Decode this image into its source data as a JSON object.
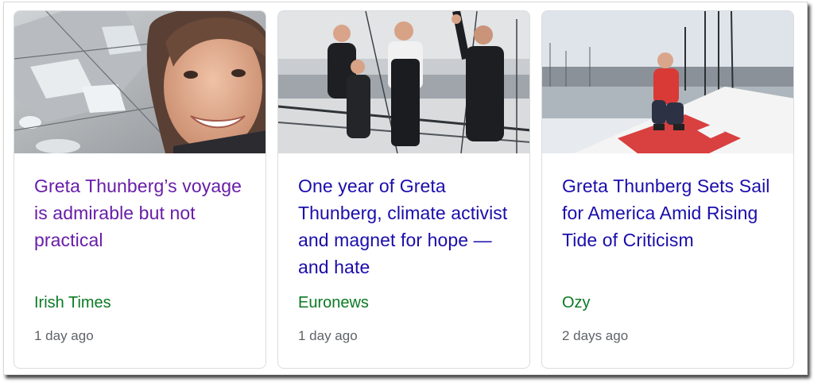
{
  "cards": [
    {
      "headline": "Greta Thunberg’s voyage is admirable but not practical",
      "source": "Irish Times",
      "age": "1 day ago",
      "headline_color": "#681da8",
      "thumbnail": "greta-closeup-photo"
    },
    {
      "headline": "One year of Greta Thunberg, climate activist and magnet for hope — and hate",
      "source": "Euronews",
      "age": "1 day ago",
      "headline_color": "#1a0dab",
      "thumbnail": "crew-on-yacht-photo"
    },
    {
      "headline": "Greta Thunberg Sets Sail for America Amid Rising Tide of Criticism",
      "source": "Ozy",
      "age": "2 days ago",
      "headline_color": "#1a0dab",
      "thumbnail": "greta-on-boat-deck-photo"
    }
  ],
  "colors": {
    "source_green": "#0a7a23",
    "age_gray": "#5f6368",
    "card_border": "#dadce0"
  }
}
